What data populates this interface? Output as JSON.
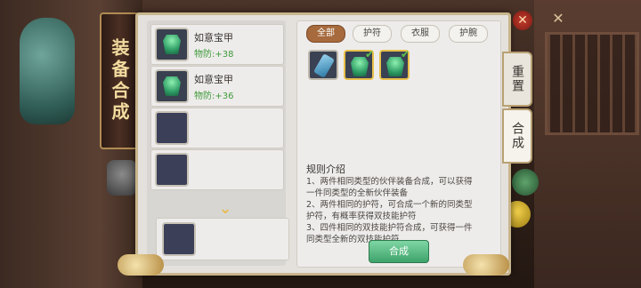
{
  "window": {
    "title": "装备合成"
  },
  "list": {
    "items": [
      {
        "name": "如意宝甲",
        "stat": "物防:+38",
        "filled": true
      },
      {
        "name": "如意宝甲",
        "stat": "物防:+36",
        "filled": true
      },
      {
        "name": "",
        "stat": "",
        "filled": false
      },
      {
        "name": "",
        "stat": "",
        "filled": false
      }
    ],
    "arrow_icon": "merge-arrow-icon"
  },
  "tabs": [
    {
      "label": "全部",
      "active": true
    },
    {
      "label": "护符",
      "active": false
    },
    {
      "label": "衣服",
      "active": false
    },
    {
      "label": "护腕",
      "active": false
    }
  ],
  "equipment": [
    {
      "icon": "bracer-icon",
      "selected": false
    },
    {
      "icon": "armor-icon",
      "selected": true
    },
    {
      "icon": "armor-icon",
      "selected": true
    }
  ],
  "rules": {
    "title": "规则介绍",
    "lines": [
      "1、两件相同类型的伙伴装备合成，可以获得",
      "一件同类型的全新伙伴装备",
      "2、两件相同的护符，可合成一个新的同类型",
      "护符，有概率获得双技能护符",
      "3、四件相同的双技能护符合成，可获得一件",
      "同类型全新的双技能护符"
    ]
  },
  "merge_button": {
    "label": "合成"
  },
  "side_tabs": [
    {
      "label": "重置",
      "active": false
    },
    {
      "label": "合成",
      "active": true
    }
  ],
  "colors": {
    "accent": "#a66a3d",
    "confirm": "#3ea36a",
    "stat": "#3f9a3a"
  }
}
